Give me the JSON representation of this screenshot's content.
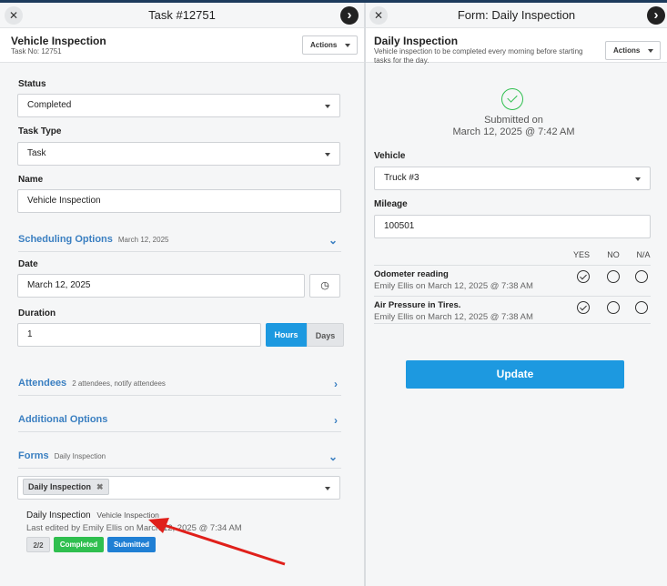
{
  "left": {
    "header_title": "Task #12751",
    "subheader": {
      "title": "Vehicle Inspection",
      "sub": "Task No: 12751",
      "actions_label": "Actions"
    },
    "status": {
      "label": "Status",
      "value": "Completed"
    },
    "task_type": {
      "label": "Task Type",
      "value": "Task"
    },
    "name": {
      "label": "Name",
      "value": "Vehicle Inspection"
    },
    "scheduling": {
      "title": "Scheduling Options",
      "summary": "March 12, 2025"
    },
    "date": {
      "label": "Date",
      "value": "March 12, 2025"
    },
    "duration": {
      "label": "Duration",
      "value": "1",
      "hours_label": "Hours",
      "days_label": "Days"
    },
    "attendees": {
      "title": "Attendees",
      "summary": "2 attendees, notify attendees"
    },
    "additional": {
      "title": "Additional Options"
    },
    "forms": {
      "title": "Forms",
      "summary": "Daily Inspection",
      "chip": "Daily Inspection"
    },
    "form_entry": {
      "name": "Daily Inspection",
      "task": "Vehicle Inspection",
      "edited": "Last edited by Emily Ellis on March 12, 2025 @ 7:34 AM",
      "count": "2/2",
      "status1": "Completed",
      "status2": "Submitted"
    }
  },
  "right": {
    "header_title": "Form: Daily Inspection",
    "subheader": {
      "title": "Daily Inspection",
      "sub": "Vehicle inspection to be completed every morning before starting tasks for the day.",
      "actions_label": "Actions"
    },
    "submitted_line1": "Submitted on",
    "submitted_line2": "March 12, 2025 @ 7:42 AM",
    "vehicle": {
      "label": "Vehicle",
      "value": "Truck #3"
    },
    "mileage": {
      "label": "Mileage",
      "value": "100501"
    },
    "columns": [
      "YES",
      "NO",
      "N/A"
    ],
    "items": [
      {
        "title": "Odometer reading",
        "meta": "Emily Ellis on March 12, 2025 @ 7:38 AM",
        "answer": "YES"
      },
      {
        "title": "Air Pressure in Tires.",
        "meta": "Emily Ellis on March 12, 2025 @ 7:38 AM",
        "answer": "YES"
      }
    ],
    "update_label": "Update"
  },
  "colors": {
    "accent": "#1d99e0",
    "link": "#3a7fc1",
    "success": "#2fbf4f",
    "submitted": "#1f7fd4",
    "arrow": "#e0201b"
  },
  "icons": [
    "close-icon",
    "chevron-right-icon",
    "caret-down-icon",
    "clock-icon",
    "chevron-down-icon",
    "check-circle-icon"
  ]
}
